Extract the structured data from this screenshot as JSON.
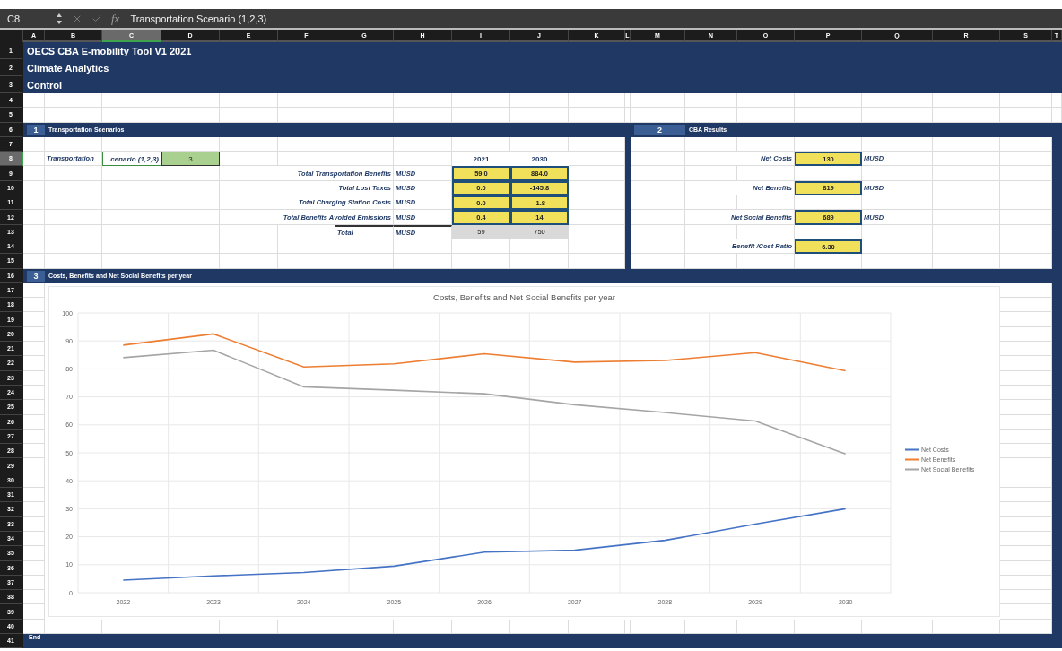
{
  "formula_bar": {
    "cell_ref": "C8",
    "function_label": "fx",
    "formula": "Transportation Scenario (1,2,3)"
  },
  "column_headers": [
    {
      "label": "A",
      "selected": false
    },
    {
      "label": "B",
      "selected": false
    },
    {
      "label": "C",
      "selected": true
    },
    {
      "label": "D",
      "selected": false
    },
    {
      "label": "E",
      "selected": false
    },
    {
      "label": "F",
      "selected": false
    },
    {
      "label": "G",
      "selected": false
    },
    {
      "label": "H",
      "selected": false
    },
    {
      "label": "I",
      "selected": false
    },
    {
      "label": "J",
      "selected": false
    },
    {
      "label": "K",
      "selected": false
    },
    {
      "label": "L",
      "selected": false
    },
    {
      "label": "M",
      "selected": false
    },
    {
      "label": "N",
      "selected": false
    },
    {
      "label": "O",
      "selected": false
    },
    {
      "label": "P",
      "selected": false
    },
    {
      "label": "Q",
      "selected": false
    },
    {
      "label": "R",
      "selected": false
    },
    {
      "label": "S",
      "selected": false
    },
    {
      "label": "T",
      "selected": false
    }
  ],
  "row_headers": [
    {
      "label": "1",
      "selected": false
    },
    {
      "label": "2",
      "selected": false
    },
    {
      "label": "3",
      "selected": false
    },
    {
      "label": "4",
      "selected": false
    },
    {
      "label": "5",
      "selected": false
    },
    {
      "label": "6",
      "selected": false
    },
    {
      "label": "7",
      "selected": false
    },
    {
      "label": "8",
      "selected": true
    },
    {
      "label": "9",
      "selected": false
    },
    {
      "label": "10",
      "selected": false
    },
    {
      "label": "11",
      "selected": false
    },
    {
      "label": "12",
      "selected": false
    },
    {
      "label": "13",
      "selected": false
    },
    {
      "label": "14",
      "selected": false
    },
    {
      "label": "15",
      "selected": false
    },
    {
      "label": "16",
      "selected": false
    },
    {
      "label": "17",
      "selected": false
    },
    {
      "label": "18",
      "selected": false
    },
    {
      "label": "19",
      "selected": false
    },
    {
      "label": "20",
      "selected": false
    },
    {
      "label": "21",
      "selected": false
    },
    {
      "label": "22",
      "selected": false
    },
    {
      "label": "23",
      "selected": false
    },
    {
      "label": "24",
      "selected": false
    },
    {
      "label": "25",
      "selected": false
    },
    {
      "label": "26",
      "selected": false
    },
    {
      "label": "27",
      "selected": false
    },
    {
      "label": "28",
      "selected": false
    },
    {
      "label": "29",
      "selected": false
    },
    {
      "label": "30",
      "selected": false
    },
    {
      "label": "31",
      "selected": false
    },
    {
      "label": "32",
      "selected": false
    },
    {
      "label": "33",
      "selected": false
    },
    {
      "label": "34",
      "selected": false
    },
    {
      "label": "35",
      "selected": false
    },
    {
      "label": "36",
      "selected": false
    },
    {
      "label": "37",
      "selected": false
    },
    {
      "label": "38",
      "selected": false
    },
    {
      "label": "39",
      "selected": false
    },
    {
      "label": "40",
      "selected": false
    },
    {
      "label": "41",
      "selected": false
    }
  ],
  "title_rows": [
    "OECS CBA E-mobility Tool V1 2021",
    "Climate Analytics",
    "Control"
  ],
  "sections": [
    {
      "number": "1",
      "title": "Transportation Scenarios"
    },
    {
      "number": "2",
      "title": "CBA Results"
    },
    {
      "number": "3",
      "title": "Costs, Benefits and Net Social Benefits per year"
    }
  ],
  "scenario": {
    "label": "Transportation",
    "cell_text": "cenario (1,2,3)",
    "value": "3"
  },
  "transport_table": {
    "years": [
      "2021",
      "2030"
    ],
    "rows": [
      {
        "label": "Total Transportation Benefits",
        "unit": "MUSD",
        "values": [
          "59.0",
          "884.0"
        ]
      },
      {
        "label": "Total Lost Taxes",
        "unit": "MUSD",
        "values": [
          "0.0",
          "-145.8"
        ]
      },
      {
        "label": "Total Charging Station Costs",
        "unit": "MUSD",
        "values": [
          "0.0",
          "-1.8"
        ]
      },
      {
        "label": "Total Benefits Avoided Emissions",
        "unit": "MUSD",
        "values": [
          "0.4",
          "14"
        ]
      }
    ],
    "total": {
      "label": "Total",
      "unit": "MUSD",
      "values": [
        "59",
        "750"
      ]
    }
  },
  "results": [
    {
      "label": "Net Costs",
      "value": "130",
      "unit": "MUSD"
    },
    {
      "label": "Net Benefits",
      "value": "819",
      "unit": "MUSD"
    },
    {
      "label": "Net Social Benefits",
      "value": "689",
      "unit": "MUSD"
    },
    {
      "label": "Benefit /Cost Ratio",
      "value": "6.30"
    }
  ],
  "chart": {
    "chart_data": {
      "type": "line",
      "title": "Costs, Benefits and Net Social Benefits per year",
      "x": [
        "2022",
        "2023",
        "2024",
        "2025",
        "2026",
        "2027",
        "2028",
        "2029",
        "2030"
      ],
      "grid": true,
      "ylim": [
        0,
        100
      ],
      "yticks": [
        0,
        10,
        20,
        30,
        40,
        50,
        60,
        70,
        80,
        90,
        100
      ],
      "series": [
        {
          "name": "Net Costs",
          "color": "#4472c4",
          "values": [
            4.5,
            6,
            7.2,
            9.5,
            14.5,
            15.2,
            18.7,
            24.5,
            30
          ]
        },
        {
          "name": "Net Benefits",
          "color": "#ed7d31",
          "values": [
            88.5,
            92.5,
            80.7,
            81.8,
            85.4,
            82.4,
            83,
            85.8,
            79.3
          ]
        },
        {
          "name": "Net Social Benefits",
          "color": "#a5a5a5",
          "values": [
            84,
            86.7,
            73.6,
            72.4,
            71.1,
            67.2,
            64.4,
            61.4,
            49.6
          ]
        }
      ]
    }
  },
  "footer": {
    "label": "End"
  }
}
